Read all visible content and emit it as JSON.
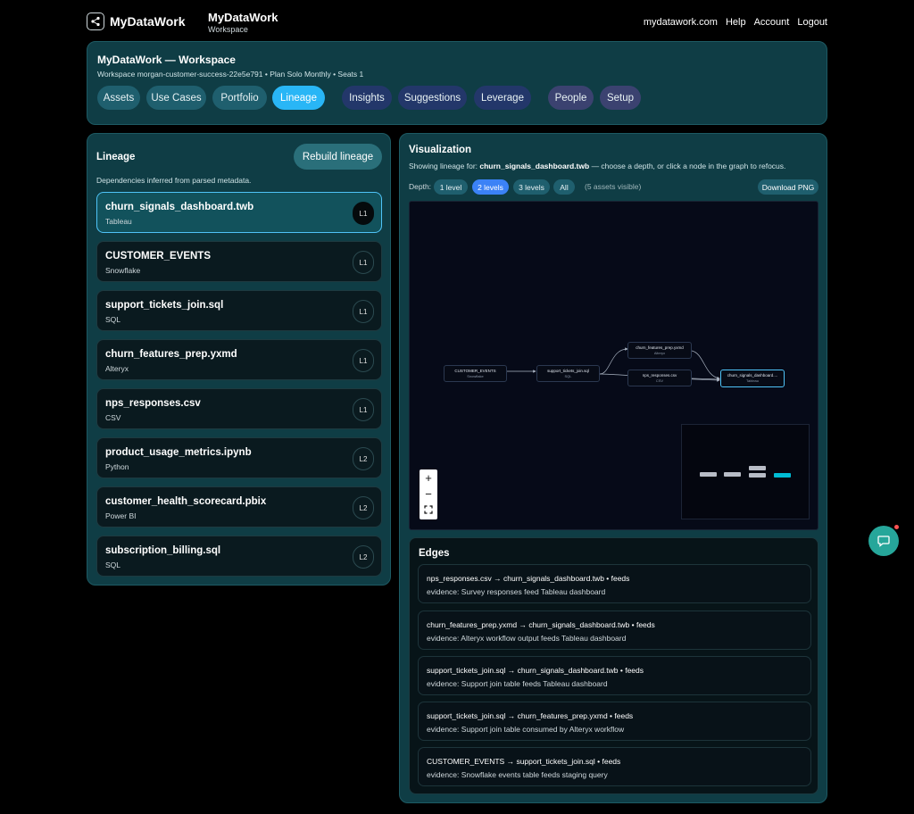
{
  "topbar": {
    "brand": "MyDataWork",
    "workspace_title": "MyDataWork",
    "workspace_subtitle": "Workspace",
    "links": [
      "mydatawork.com",
      "Help",
      "Account",
      "Logout"
    ]
  },
  "header": {
    "title": "MyDataWork — Workspace",
    "subtitle": "Workspace morgan-customer-success-22e5e791 • Plan Solo Monthly • Seats 1",
    "tabs": [
      {
        "label": "Assets"
      },
      {
        "label": "Use Cases"
      },
      {
        "label": "Portfolio"
      },
      {
        "label": "Lineage",
        "active": true
      },
      {
        "label": "Insights"
      },
      {
        "label": "Suggestions"
      },
      {
        "label": "Leverage"
      },
      {
        "label": "People"
      },
      {
        "label": "Setup"
      }
    ]
  },
  "lineage": {
    "title": "Lineage",
    "rebuild_label": "Rebuild lineage",
    "subtitle": "Dependencies inferred from parsed metadata.",
    "assets": [
      {
        "name": "churn_signals_dashboard.twb",
        "type": "Tableau",
        "level": "L1",
        "selected": true
      },
      {
        "name": "CUSTOMER_EVENTS",
        "type": "Snowflake",
        "level": "L1"
      },
      {
        "name": "support_tickets_join.sql",
        "type": "SQL",
        "level": "L1"
      },
      {
        "name": "churn_features_prep.yxmd",
        "type": "Alteryx",
        "level": "L1"
      },
      {
        "name": "nps_responses.csv",
        "type": "CSV",
        "level": "L1"
      },
      {
        "name": "product_usage_metrics.ipynb",
        "type": "Python",
        "level": "L2"
      },
      {
        "name": "customer_health_scorecard.pbix",
        "type": "Power BI",
        "level": "L2"
      },
      {
        "name": "subscription_billing.sql",
        "type": "SQL",
        "level": "L2"
      }
    ]
  },
  "visualization": {
    "title": "Visualization",
    "sub_prefix": "Showing lineage for: ",
    "sub_asset": "churn_signals_dashboard.twb",
    "sub_suffix": " — choose a depth, or click a node in the graph to refocus.",
    "depth_label": "Depth:",
    "depth_options": [
      "1 level",
      "2 levels",
      "3 levels",
      "All"
    ],
    "depth_selected": "2 levels",
    "visible_count": "(5 assets visible)",
    "download_label": "Download PNG",
    "nodes": [
      {
        "name": "CUSTOMER_EVENTS",
        "type": "Snowflake"
      },
      {
        "name": "support_tickets_join.sql",
        "type": "SQL"
      },
      {
        "name": "churn_features_prep.yxmd",
        "type": "Alteryx"
      },
      {
        "name": "nps_responses.csv",
        "type": "CSV"
      },
      {
        "name": "churn_signals_dashboard....",
        "type": "Tableau"
      }
    ],
    "zoom_in": "+",
    "zoom_out": "−"
  },
  "edges": {
    "title": "Edges",
    "items": [
      {
        "relation": "nps_responses.csv → churn_signals_dashboard.twb • feeds",
        "evidence": "evidence: Survey responses feed Tableau dashboard"
      },
      {
        "relation": "churn_features_prep.yxmd → churn_signals_dashboard.twb • feeds",
        "evidence": "evidence: Alteryx workflow output feeds Tableau dashboard"
      },
      {
        "relation": "support_tickets_join.sql → churn_signals_dashboard.twb • feeds",
        "evidence": "evidence: Support join table feeds Tableau dashboard"
      },
      {
        "relation": "support_tickets_join.sql → churn_features_prep.yxmd • feeds",
        "evidence": "evidence: Support join table consumed by Alteryx workflow"
      },
      {
        "relation": "CUSTOMER_EVENTS → support_tickets_join.sql • feeds",
        "evidence": "evidence: Snowflake events table feeds staging query"
      }
    ]
  },
  "colors": {
    "panel": "#0f3d45",
    "accent": "#29b6f6",
    "selected_node": "#4fc3f7",
    "chat": "#26a69a"
  }
}
